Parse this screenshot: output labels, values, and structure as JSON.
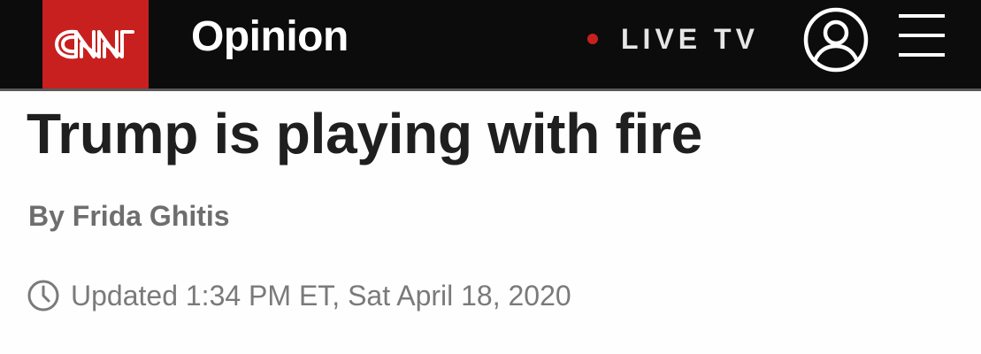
{
  "header": {
    "logo_text": "CNN",
    "section": "Opinion",
    "live_tv_label": "LIVE TV",
    "icons": {
      "account": "user-circle-icon",
      "menu": "hamburger-menu-icon",
      "live": "live-dot-icon"
    }
  },
  "article": {
    "headline": "Trump is playing with fire",
    "byline_prefix": "By",
    "author": "Frida Ghitis",
    "updated": "Updated 1:34 PM ET, Sat April 18, 2020",
    "clock_icon": "clock-icon"
  },
  "colors": {
    "brand_red": "#c8201e",
    "header_bg": "#0c0c0c",
    "headline": "#1f1f1f",
    "byline": "#6e6e6e",
    "timestamp": "#7a7a7a"
  }
}
